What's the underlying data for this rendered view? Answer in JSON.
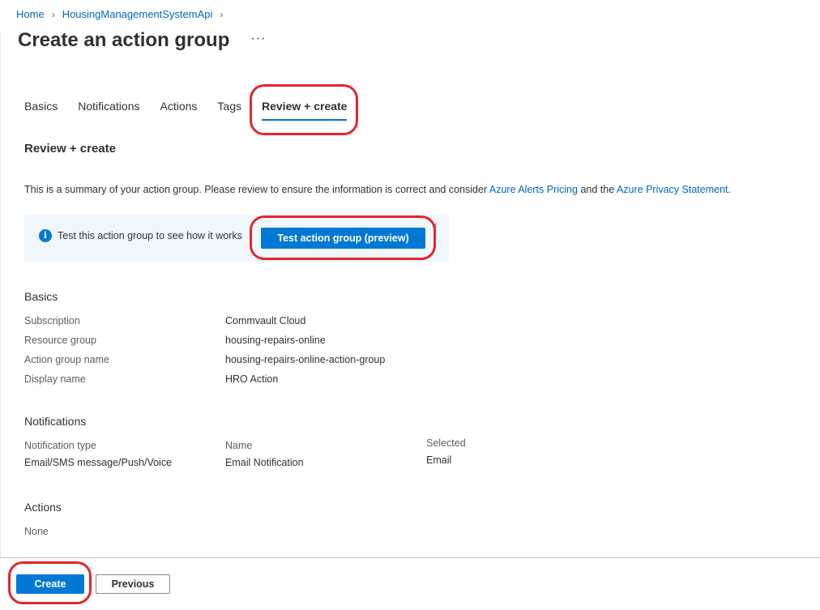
{
  "breadcrumb": {
    "home": "Home",
    "resource": "HousingManagementSystemApi"
  },
  "header": {
    "title": "Create an action group",
    "more": "···"
  },
  "tabs": [
    {
      "label": "Basics",
      "active": false
    },
    {
      "label": "Notifications",
      "active": false
    },
    {
      "label": "Actions",
      "active": false
    },
    {
      "label": "Tags",
      "active": false
    },
    {
      "label": "Review + create",
      "active": true
    }
  ],
  "review": {
    "heading": "Review + create",
    "summary_prefix": "This is a summary of your action group. Please review to ensure the information is correct and consider ",
    "link_pricing": "Azure Alerts Pricing",
    "summary_middle": " and the ",
    "link_privacy": "Azure Privacy Statement",
    "summary_suffix": "."
  },
  "infobar": {
    "text": "Test this action group to see how it works",
    "button": "Test action group (preview)",
    "close": "×"
  },
  "basics": {
    "heading": "Basics",
    "rows": [
      {
        "label": "Subscription",
        "value": "Commvault Cloud"
      },
      {
        "label": "Resource group",
        "value": "housing-repairs-online"
      },
      {
        "label": "Action group name",
        "value": "housing-repairs-online-action-group"
      },
      {
        "label": "Display name",
        "value": "HRO Action"
      }
    ]
  },
  "notifications": {
    "heading": "Notifications",
    "columns": [
      "Notification type",
      "Name",
      "Selected"
    ],
    "rows": [
      {
        "type": "Email/SMS message/Push/Voice",
        "name": "Email Notification",
        "selected": "Email"
      }
    ]
  },
  "actions": {
    "heading": "Actions",
    "value": "None"
  },
  "footer": {
    "create": "Create",
    "previous": "Previous"
  },
  "colors": {
    "accent": "#0078d4",
    "link": "#0067b8",
    "annotation": "#e3262b",
    "infobar_bg": "#eff6fc"
  }
}
